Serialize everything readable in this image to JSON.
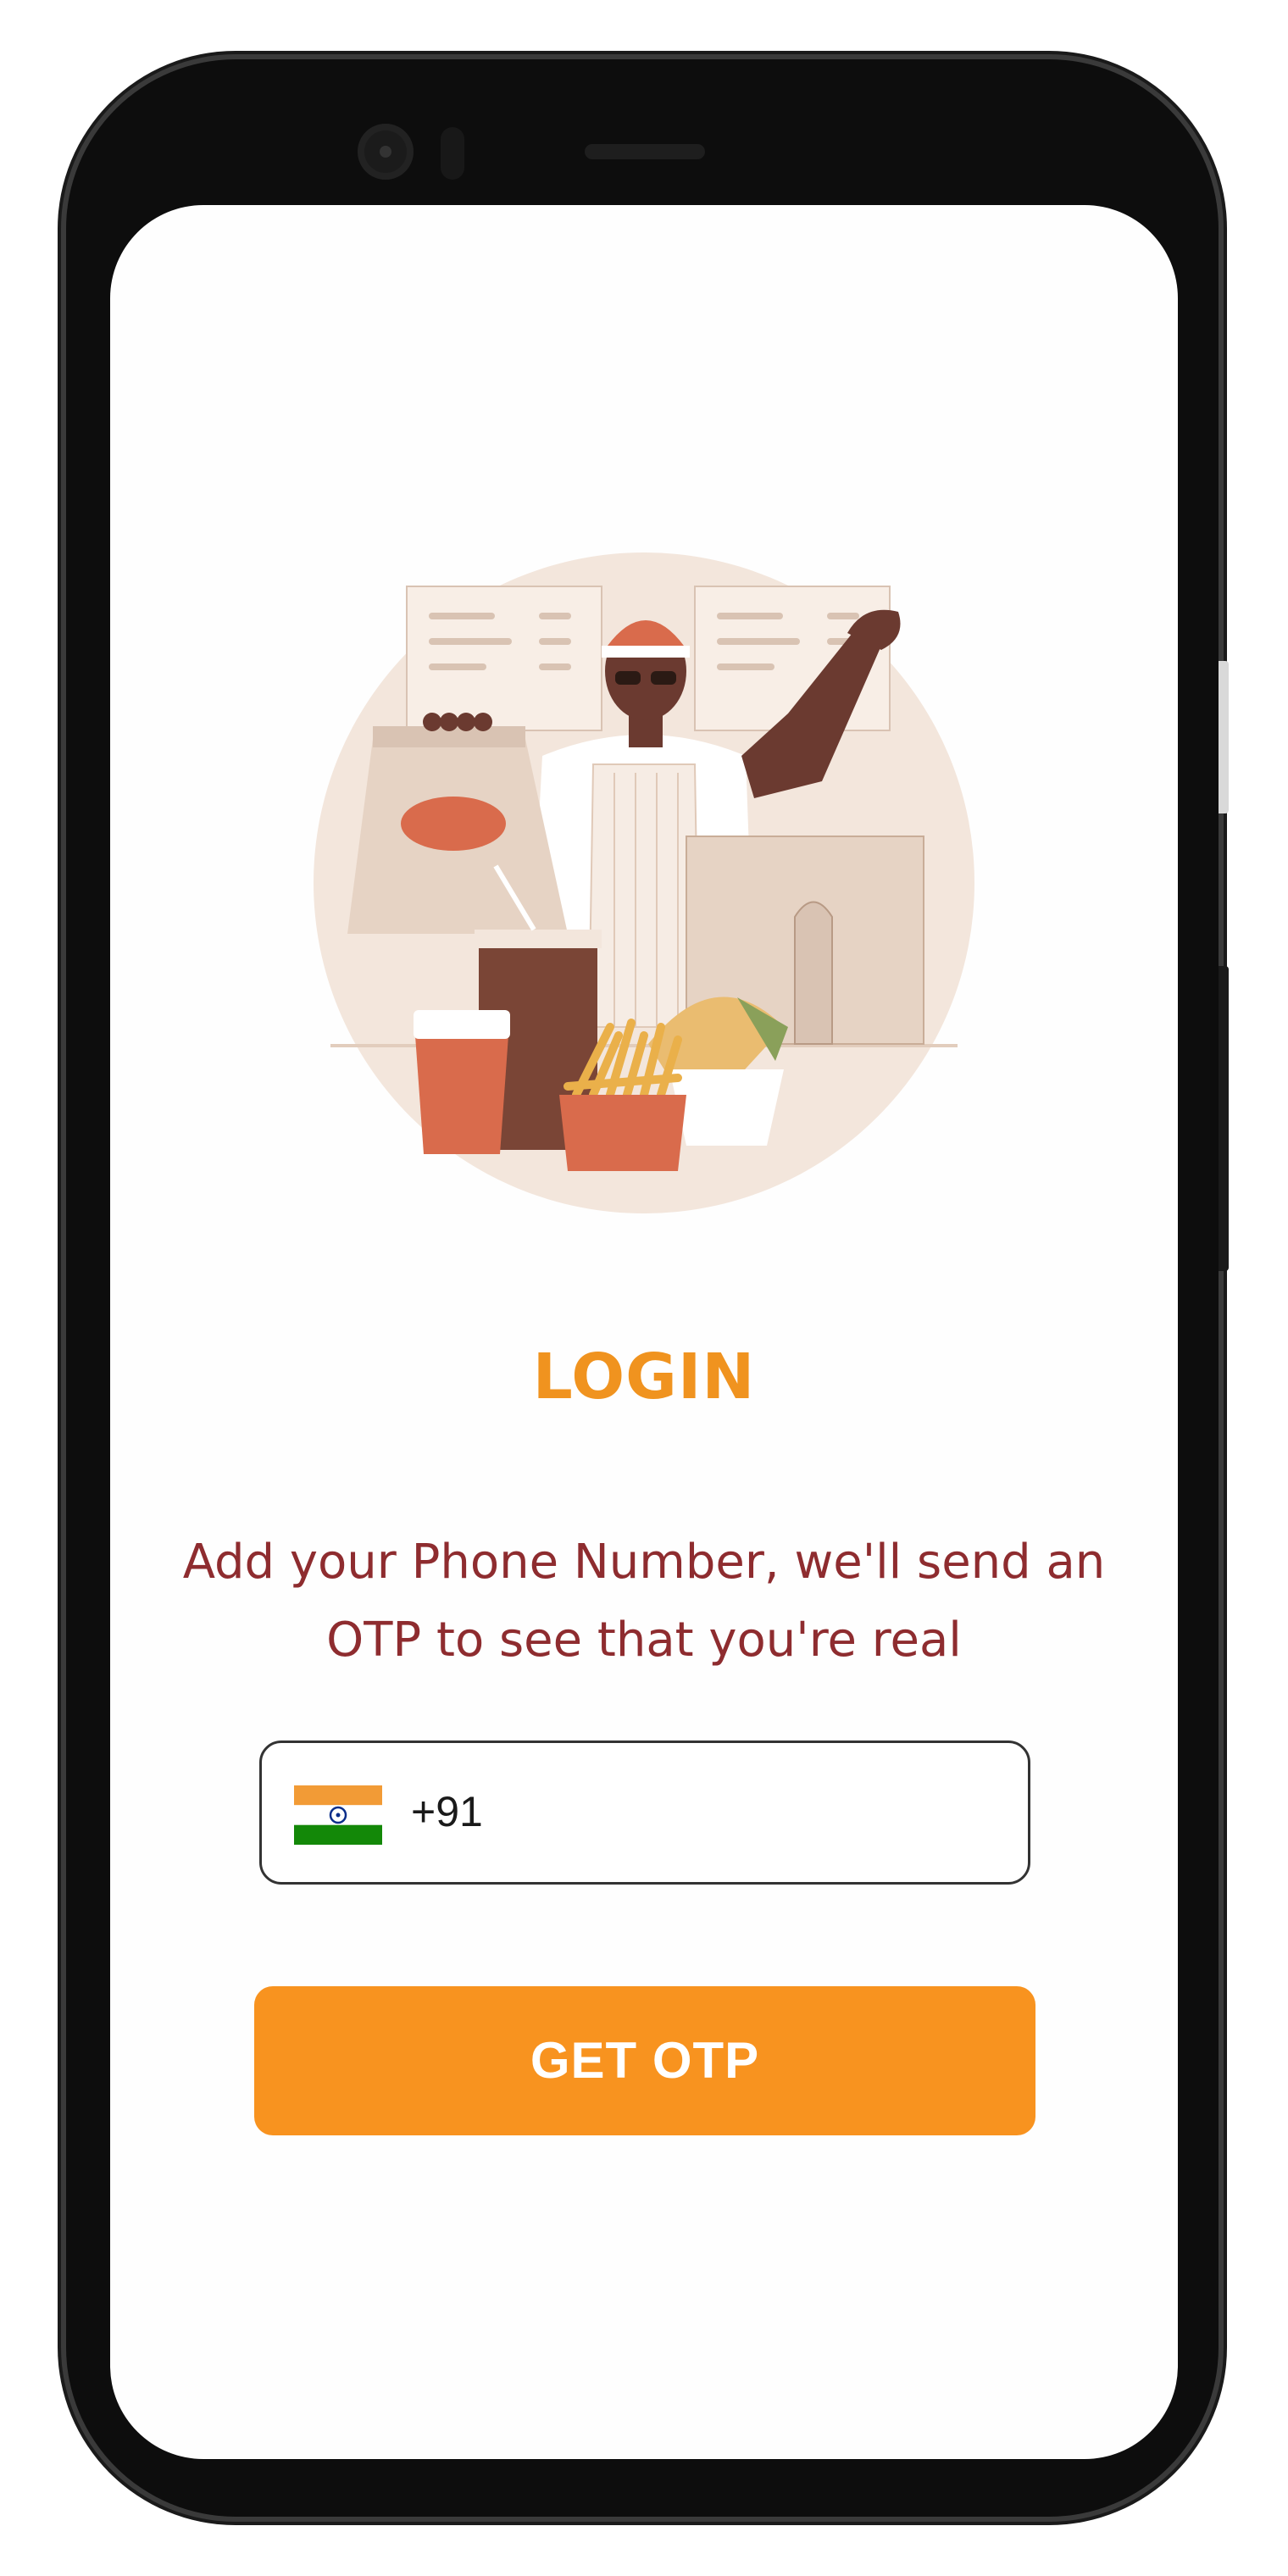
{
  "login": {
    "title": "LOGIN",
    "subtitle": "Add your Phone Number, we'll send an OTP to see that you're real",
    "phone": {
      "country_code": "+91",
      "value": "",
      "flag_icon": "india-flag-icon"
    },
    "submit_label": "GET OTP"
  },
  "colors": {
    "title": "#f0931f",
    "subtitle": "#8e2c2f",
    "button": "#f8931f",
    "illustration_bg": "#f3e6dc"
  },
  "illustration": "food-vendor-illustration"
}
